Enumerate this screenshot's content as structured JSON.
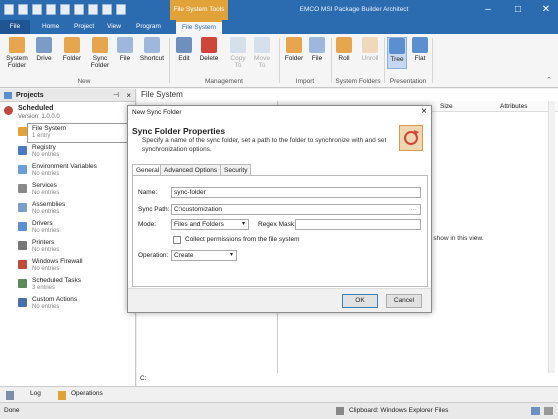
{
  "app": {
    "title": "EMCO MSI Package Builder Architect",
    "context_tab_header": "File System Tools"
  },
  "tabs": {
    "file": "File",
    "home": "Home",
    "project": "Project",
    "view": "View",
    "program": "Program",
    "file_system": "File System"
  },
  "ribbon": {
    "system_folder": "System Folder",
    "drive": "Drive",
    "folder": "Folder",
    "sync_folder": "Sync Folder",
    "file": "File",
    "shortcut": "Shortcut",
    "new_group": "New",
    "edit": "Edit",
    "delete": "Delete",
    "copy_to": "Copy To",
    "move_to": "Move To",
    "management_group": "Management",
    "import_folder": "Folder",
    "import_file": "File",
    "import_group": "Import",
    "roll": "Roll",
    "unroll": "Unroll",
    "system_folders_group": "System Folders",
    "tree": "Tree",
    "flat": "Flat",
    "presentation_group": "Presentation"
  },
  "projects": {
    "title": "Projects",
    "project_name": "Scheduled",
    "version": "Version: 1.0.0.0",
    "items": [
      {
        "name": "File System",
        "sub": "1 entry",
        "color": "#e1a23a"
      },
      {
        "name": "Registry",
        "sub": "No entries",
        "color": "#4a7bc0"
      },
      {
        "name": "Environment Variables",
        "sub": "No entries",
        "color": "#6a9fd8"
      },
      {
        "name": "Services",
        "sub": "No entries",
        "color": "#8a8a8a"
      },
      {
        "name": "Assemblies",
        "sub": "No entries",
        "color": "#7aa0c8"
      },
      {
        "name": "Drivers",
        "sub": "No entries",
        "color": "#5a8fd0"
      },
      {
        "name": "Printers",
        "sub": "No entries",
        "color": "#777"
      },
      {
        "name": "Windows Firewall",
        "sub": "No entries",
        "color": "#c04a3a"
      },
      {
        "name": "Scheduled Tasks",
        "sub": "3 entries",
        "color": "#5a8a5a"
      },
      {
        "name": "Custom Actions",
        "sub": "No entries",
        "color": "#4a6fa8"
      }
    ]
  },
  "main": {
    "title": "File System",
    "col_size": "Size",
    "col_attributes": "Attributes",
    "empty_message": "o show in this view.",
    "path": "C:"
  },
  "bottom": {
    "log": "Log",
    "operations": "Operations"
  },
  "status": {
    "left": "Done",
    "clipboard": "Clipboard: Windows Explorer Files"
  },
  "dialog": {
    "title": "New Sync Folder",
    "heading": "Sync Folder Properties",
    "description": "Specify a name of the sync folder, set a path to the folder to synchronize with and set synchronization options.",
    "tabs": [
      "General",
      "Advanced Options",
      "Security"
    ],
    "name_label": "Name:",
    "name_value": "sync-folder",
    "sync_path_label": "Sync Path:",
    "sync_path_value": "C:\\customization",
    "mode_label": "Mode:",
    "mode_value": "Files and Folders",
    "regex_label": "Regex Mask:",
    "collect_label": "Collect permissions from the file system",
    "operation_label": "Operation:",
    "operation_value": "Create",
    "ok": "OK",
    "cancel": "Cancel"
  }
}
